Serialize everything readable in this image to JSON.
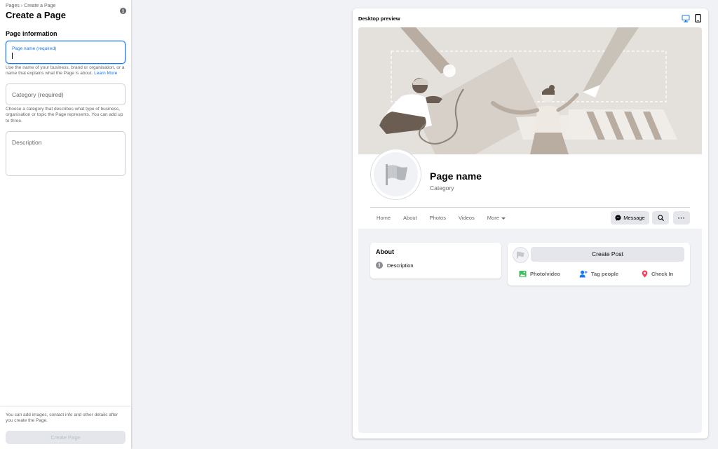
{
  "left": {
    "breadcrumb": [
      "Pages",
      "Create a Page"
    ],
    "breadcrumb_sep": "›",
    "title": "Create a Page",
    "section_title": "Page information",
    "page_name": {
      "label": "Page name (required)",
      "value": ""
    },
    "page_name_help": "Use the name of your business, brand or organisation, or a name that explains what the Page is about.",
    "learn_more": "Learn More",
    "category": {
      "placeholder": "Category (required)"
    },
    "category_help": "Choose a category that describes what type of business, organisation or topic the Page represents. You can add up to three.",
    "description": {
      "placeholder": "Description"
    },
    "footer_text": "You can add images, contact info and other details after you create the Page.",
    "create_button": "Create Page"
  },
  "preview": {
    "title": "Desktop preview",
    "page_name": "Page name",
    "category": "Category",
    "tabs": [
      "Home",
      "About",
      "Photos",
      "Videos",
      "More"
    ],
    "message_button": "Message",
    "more_button": "···",
    "about_title": "About",
    "about_description": "Description",
    "create_post": "Create Post",
    "actions": [
      "Photo/video",
      "Tag people",
      "Check In"
    ]
  },
  "colors": {
    "accent": "#1877f2",
    "photo_green": "#45bd62",
    "checkin_red": "#f3425f"
  },
  "icons": [
    "info-icon",
    "desktop-icon",
    "mobile-icon",
    "flag-icon",
    "messenger-icon",
    "search-icon",
    "more-icon",
    "photo-icon",
    "tag-people-icon",
    "check-in-icon"
  ]
}
